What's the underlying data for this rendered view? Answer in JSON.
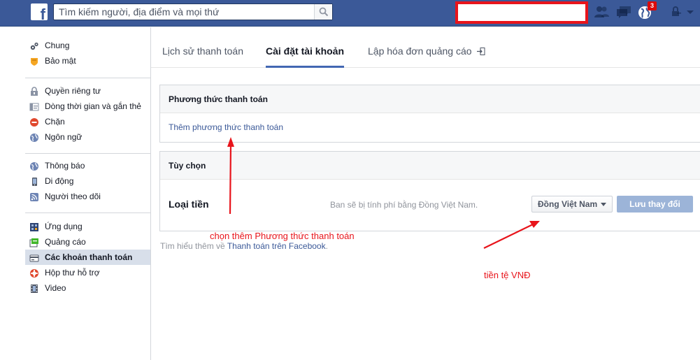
{
  "header": {
    "logo_letter": "f",
    "search_placeholder": "Tìm kiếm người, địa điểm và mọi thứ",
    "notification_count": "3"
  },
  "nav": {
    "group1": [
      {
        "label": "Chung",
        "icon": "gears-icon"
      },
      {
        "label": "Bảo mật",
        "icon": "badge-icon"
      }
    ],
    "group2": [
      {
        "label": "Quyền riêng tư",
        "icon": "lock-icon"
      },
      {
        "label": "Dòng thời gian và gắn thẻ",
        "icon": "timeline-icon"
      },
      {
        "label": "Chặn",
        "icon": "block-icon"
      },
      {
        "label": "Ngôn ngữ",
        "icon": "globe-icon"
      }
    ],
    "group3": [
      {
        "label": "Thông báo",
        "icon": "globe-icon"
      },
      {
        "label": "Di động",
        "icon": "phone-icon"
      },
      {
        "label": "Người theo dõi",
        "icon": "rss-icon"
      }
    ],
    "group4": [
      {
        "label": "Ứng dụng",
        "icon": "apps-icon"
      },
      {
        "label": "Quảng cáo",
        "icon": "ads-icon"
      },
      {
        "label": "Các khoản thanh toán",
        "icon": "card-icon",
        "active": true
      },
      {
        "label": "Hộp thư hỗ trợ",
        "icon": "lifebuoy-icon"
      },
      {
        "label": "Video",
        "icon": "film-icon"
      }
    ]
  },
  "tabs": {
    "history": "Lịch sử thanh toán",
    "settings": "Cài đặt tài khoản",
    "invoice": "Lập hóa đơn quảng cáo"
  },
  "payment_methods": {
    "title": "Phương thức thanh toán",
    "add_link": "Thêm phương thức thanh toán"
  },
  "options": {
    "title": "Tùy chọn",
    "currency_label": "Loại tiền",
    "currency_note": "Ban sẽ bị tính phí bằng Đồng Việt Nam.",
    "currency_value": "Đồng Việt Nam",
    "save_label": "Lưu thay đổi"
  },
  "learn_more": {
    "prefix": "Tìm hiểu thêm về ",
    "link": "Thanh toán trên Facebook",
    "suffix": "."
  },
  "annotations": {
    "add_method": "chọn thêm Phương thức thanh toán",
    "currency": "tiền tệ VNĐ",
    "color": "#e8141b"
  },
  "colors": {
    "brand": "#3b5998",
    "active_tab": "#4267b2",
    "save_button": "#9cb4d8"
  }
}
